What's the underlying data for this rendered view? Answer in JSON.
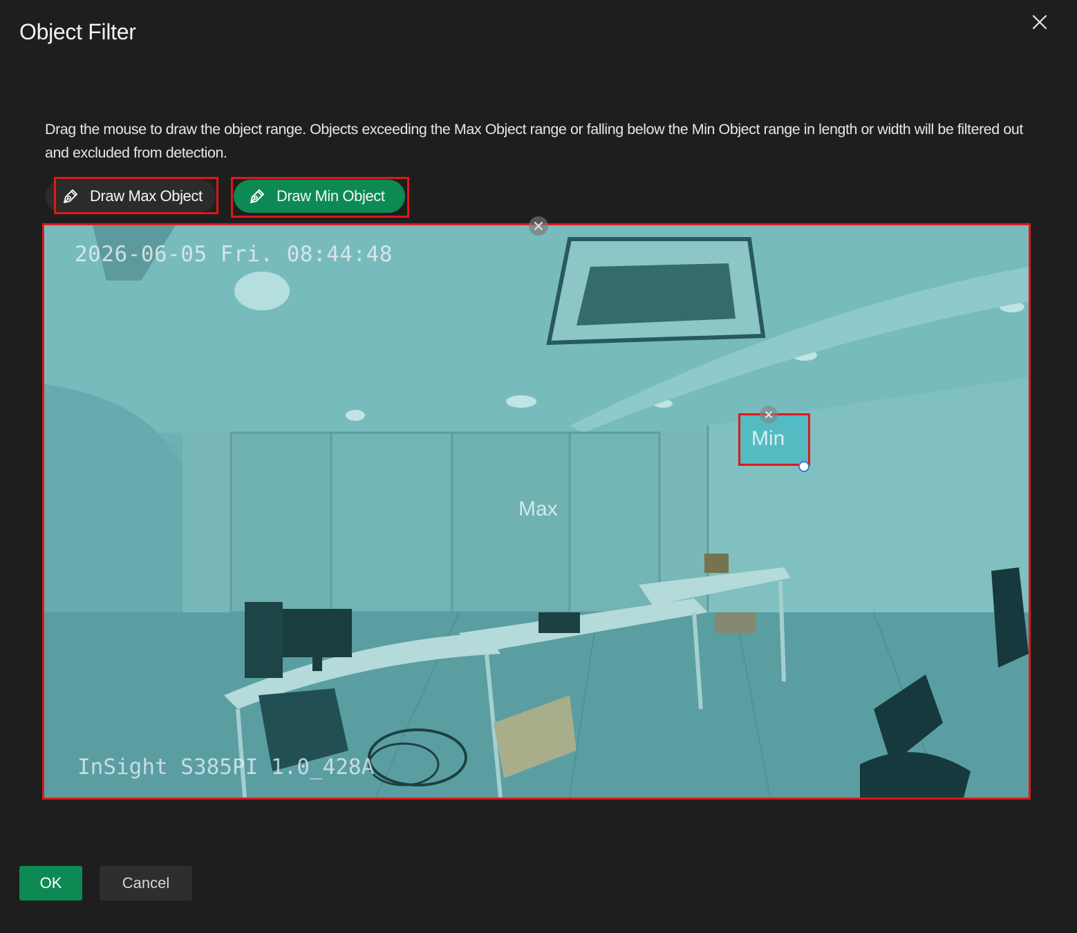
{
  "dialog": {
    "title": "Object Filter",
    "close_icon": "close-icon"
  },
  "description": "Drag the mouse to draw the object range. Objects exceeding the Max Object range or falling below the Min Object range in length or width will be filtered out and excluded from detection.",
  "toolbar": {
    "draw_max_label": "Draw Max Object",
    "draw_min_label": "Draw Min Object",
    "active_tool": "Draw Min Object",
    "pen_icon": "pen-tool-icon"
  },
  "camera": {
    "timestamp": "2026-06-05 Fri. 08:44:48",
    "model": "InSight S385PI 1.0_428A",
    "max_label": "Max",
    "min_label": "Min"
  },
  "footer": {
    "ok_label": "OK",
    "cancel_label": "Cancel"
  },
  "colors": {
    "background": "#1e1e1f",
    "accent": "#0d8a54",
    "highlight": "#e01818",
    "overlay": "#46b9c3"
  }
}
